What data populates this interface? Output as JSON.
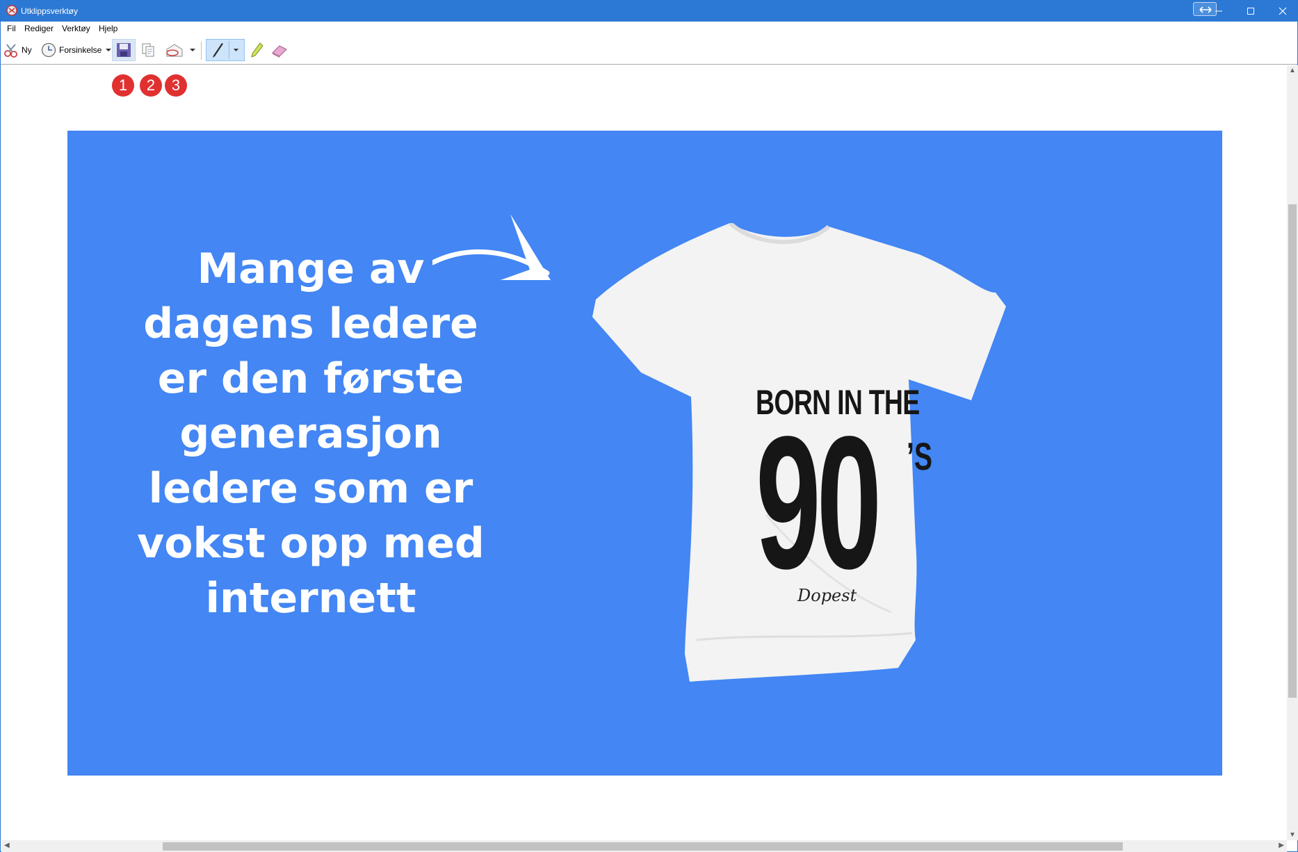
{
  "window": {
    "title": "Utklippsverktøy",
    "app_icon": "scissors-app-icon",
    "controls": [
      "minimize-icon",
      "maximize-icon",
      "close-icon"
    ]
  },
  "menu": {
    "items": [
      {
        "label": "Fil"
      },
      {
        "label": "Rediger"
      },
      {
        "label": "Verktøy"
      },
      {
        "label": "Hjelp"
      }
    ]
  },
  "toolbar": {
    "new_label": "Ny",
    "delay_label": "Forsinkelse",
    "icons": [
      "new-snip-icon",
      "delay-clock-icon",
      "save-icon",
      "copy-icon",
      "send-snip-icon",
      "pen-icon",
      "highlighter-icon",
      "eraser-icon"
    ]
  },
  "badges": [
    "1",
    "2",
    "3"
  ],
  "banner": {
    "headline_lines": [
      "Mange av",
      "dagens ledere",
      "er den første",
      "generasjon",
      "ledere som er",
      "vokst opp med",
      "internett"
    ],
    "shirt_text": {
      "line1": "BORN IN THE",
      "line2": "90",
      "line3": "’S",
      "brand": "Dopest"
    },
    "colors": {
      "background": "#4386f4",
      "headline": "#ffffff",
      "shirt": "#f3f3f3",
      "shirt_print": "#161616"
    }
  },
  "colors": {
    "titlebar": "#2b79d4",
    "badge": "#e03030"
  }
}
